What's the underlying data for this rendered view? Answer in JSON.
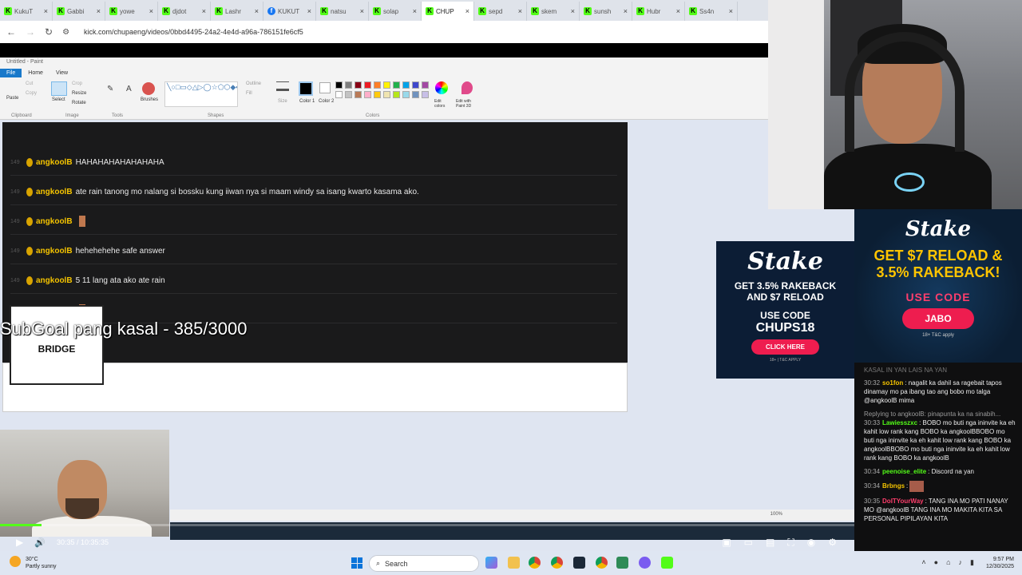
{
  "browser": {
    "tabs": [
      {
        "title": "KukuT",
        "icon": "kick-icon"
      },
      {
        "title": "Gabbi",
        "icon": "kick-icon"
      },
      {
        "title": "yowe",
        "icon": "kick-icon"
      },
      {
        "title": "djdot",
        "icon": "kick-icon"
      },
      {
        "title": "Lashr",
        "icon": "kick-icon"
      },
      {
        "title": "KUKUT",
        "icon": "facebook-icon"
      },
      {
        "title": "natsu",
        "icon": "kick-icon"
      },
      {
        "title": "solap",
        "icon": "kick-icon"
      },
      {
        "title": "CHUP",
        "icon": "kick-icon",
        "active": true
      },
      {
        "title": "sepd",
        "icon": "kick-icon"
      },
      {
        "title": "skem",
        "icon": "kick-icon"
      },
      {
        "title": "sunsh",
        "icon": "kick-icon"
      },
      {
        "title": "Hubr",
        "icon": "kick-icon"
      },
      {
        "title": "Ss4n",
        "icon": "kick-icon"
      }
    ],
    "url": "kick.com/chupaeng/videos/0bbd4495-24a2-4e4d-a96a-786151fe6cf5"
  },
  "paint": {
    "title": "Untitled - Paint",
    "menu": [
      "File",
      "Home",
      "View"
    ],
    "groups": [
      "Clipboard",
      "Image",
      "Tools",
      "Shapes",
      "Colors"
    ],
    "tools": {
      "paste": "Paste",
      "cut": "Cut",
      "copy": "Copy",
      "select": "Select",
      "crop": "Crop",
      "resize": "Resize",
      "rotate": "Rotate",
      "brushes": "Brushes",
      "outline": "Outline",
      "fill": "Fill",
      "size": "Size",
      "color1": "Color 1",
      "color2": "Color 2",
      "edit_colors": "Edit colors",
      "paint3d": "Edit with Paint 3D"
    },
    "palette": [
      "#000000",
      "#7f7f7f",
      "#880015",
      "#ed1c24",
      "#ff7f27",
      "#fff200",
      "#22b14c",
      "#00a2e8",
      "#3f48cc",
      "#a349a4",
      "#ffffff",
      "#c3c3c3",
      "#b97a57",
      "#ffaec9",
      "#ffc90e",
      "#efe4b0",
      "#b5e61d",
      "#99d9ea",
      "#7092be",
      "#c8bfe7"
    ],
    "zoom": "100%"
  },
  "overlay": {
    "subgoal": "SubGoal pang kasal - 385/3000",
    "bridge_caption": "BRIDGE"
  },
  "chat_capture": [
    {
      "num": "149",
      "user": "angkoolB",
      "text": "HAHAHAHAHAHAHAHA"
    },
    {
      "num": "149",
      "user": "angkoolB",
      "text": "ate rain tanong mo nalang si bossku kung iiwan nya si maam windy sa isang kwarto kasama ako."
    },
    {
      "num": "149",
      "user": "angkoolB",
      "text": ""
    },
    {
      "num": "149",
      "user": "angkoolB",
      "text": "hehehehehe safe answer"
    },
    {
      "num": "149",
      "user": "angkoolB",
      "text": "5 11 lang ata ako ate rain"
    },
    {
      "num": "149",
      "user": "angkoolB",
      "text": ""
    }
  ],
  "stake_ad": {
    "logo": "Stake",
    "line1": "GET 3.5% RAKEBACK",
    "line2": "AND $7 RELOAD",
    "use_code": "USE CODE",
    "code": "CHUPS18",
    "button": "CLICK HERE",
    "fine": "18+ | T&C APPLY"
  },
  "side_ad": {
    "logo": "Stake",
    "line1": "GET $7 RELOAD &",
    "line2": "3.5% RAKEBACK!",
    "use_code": "USE CODE",
    "code": "JABO",
    "fine": "18+ T&C apply"
  },
  "player": {
    "time": "30:35 / 10:35:35",
    "progress": 0.049
  },
  "chat": {
    "top_partial": "KASAL IN YAN LAIS NA YAN",
    "messages": [
      {
        "time": "30:32",
        "user": "so1fon",
        "color": "#f5c400",
        "text": "nagalit ka dahil sa ragebait tapos dinamay mo pa ibang tao ang bobo mo talga @angkoolB mima"
      },
      {
        "time": "30:33",
        "user": "Lawiesszxc",
        "color": "#53fc18",
        "reply": "Replying to angkoolB: pinapunta ka na sinabih...",
        "text": "BOBO mo buti nga ininvite ka eh kahit low rank kang BOBO ka angkoolBBOBO mo buti nga ininvite ka eh kahit low rank kang BOBO ka angkoolBBOBO mo buti nga ininvite ka eh kahit low rank kang BOBO ka angkoolB"
      },
      {
        "time": "30:34",
        "user": "peenoise_elite",
        "color": "#53fc18",
        "text": "Discord na yan"
      },
      {
        "time": "30:34",
        "user": "Brbngs",
        "color": "#f5c400",
        "text": ""
      },
      {
        "time": "30:35",
        "user": "DoITYourWay",
        "color": "#ff3e6c",
        "text": "TANG INA MO PATI NANAY MO @angkoolB TANG INA MO MAKITA KITA SA PERSONAL PIPILAYAN KITA"
      }
    ]
  },
  "taskbar": {
    "weather_temp": "30°C",
    "weather_desc": "Partly sunny",
    "search": "Search",
    "time": "9:57 PM",
    "date": "12/30/2025"
  }
}
